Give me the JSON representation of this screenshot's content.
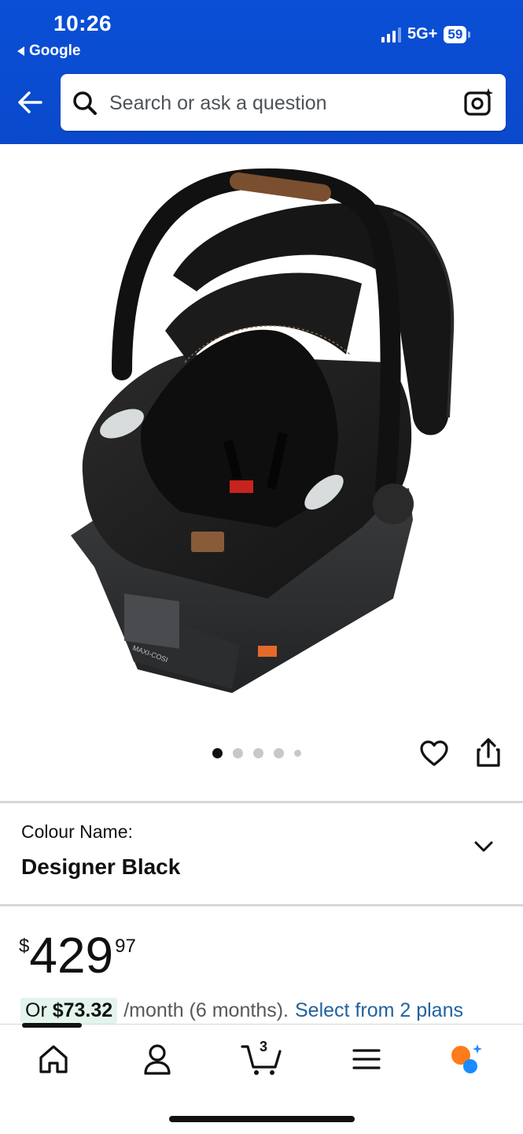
{
  "status_bar": {
    "time": "10:26",
    "back_app": "Google",
    "network": "5G+",
    "battery": "59"
  },
  "search": {
    "placeholder": "Search or ask a question"
  },
  "product": {
    "image_alt": "Infant car seat",
    "brand_mark": "MAXI-COSI",
    "carousel": {
      "total_dots": 5,
      "active_index": 0
    },
    "colour_label": "Colour Name:",
    "colour_value": "Designer Black",
    "price": {
      "symbol": "$",
      "whole": "429",
      "fraction": "97"
    },
    "monthly": {
      "or_text": "Or ",
      "amount": "$73.32",
      "term": "/month (6 months).",
      "plans_link": "Select from 2 plans"
    }
  },
  "bottom_nav": {
    "cart_count": "3",
    "items": [
      "home-icon",
      "account-icon",
      "cart-icon",
      "menu-icon",
      "rufus-icon"
    ]
  },
  "colors": {
    "header_blue": "#0a4fd6",
    "link_blue": "#2162a1",
    "chip_green": "#e3f4ec",
    "rufus_orange": "#ff7a1a",
    "rufus_blue": "#1a8cff"
  }
}
